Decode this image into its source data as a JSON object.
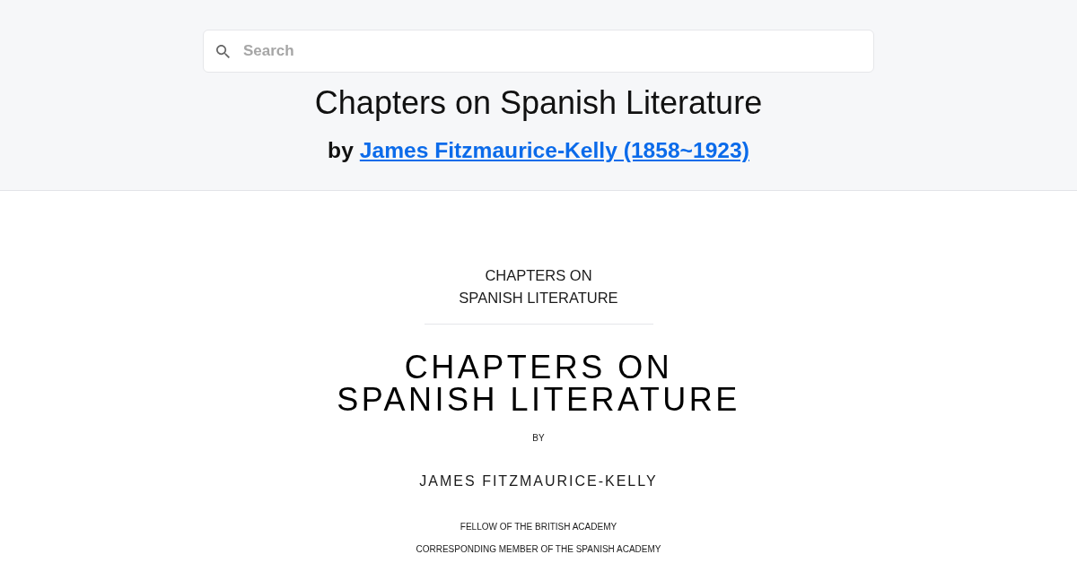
{
  "search": {
    "placeholder": "Search"
  },
  "header": {
    "title": "Chapters on Spanish Literature",
    "by_label": "by",
    "author_link": "James Fitzmaurice-Kelly (1858~1923)"
  },
  "book": {
    "half_title_lines": [
      "CHAPTERS ON",
      "SPANISH LITERATURE"
    ],
    "title_lines": [
      "CHAPTERS ON",
      "SPANISH LITERATURE"
    ],
    "by": "BY",
    "author": "JAMES FITZMAURICE-KELLY",
    "credentials": [
      "FELLOW OF THE BRITISH ACADEMY",
      "CORRESPONDING MEMBER OF THE SPANISH ACADEMY"
    ]
  }
}
